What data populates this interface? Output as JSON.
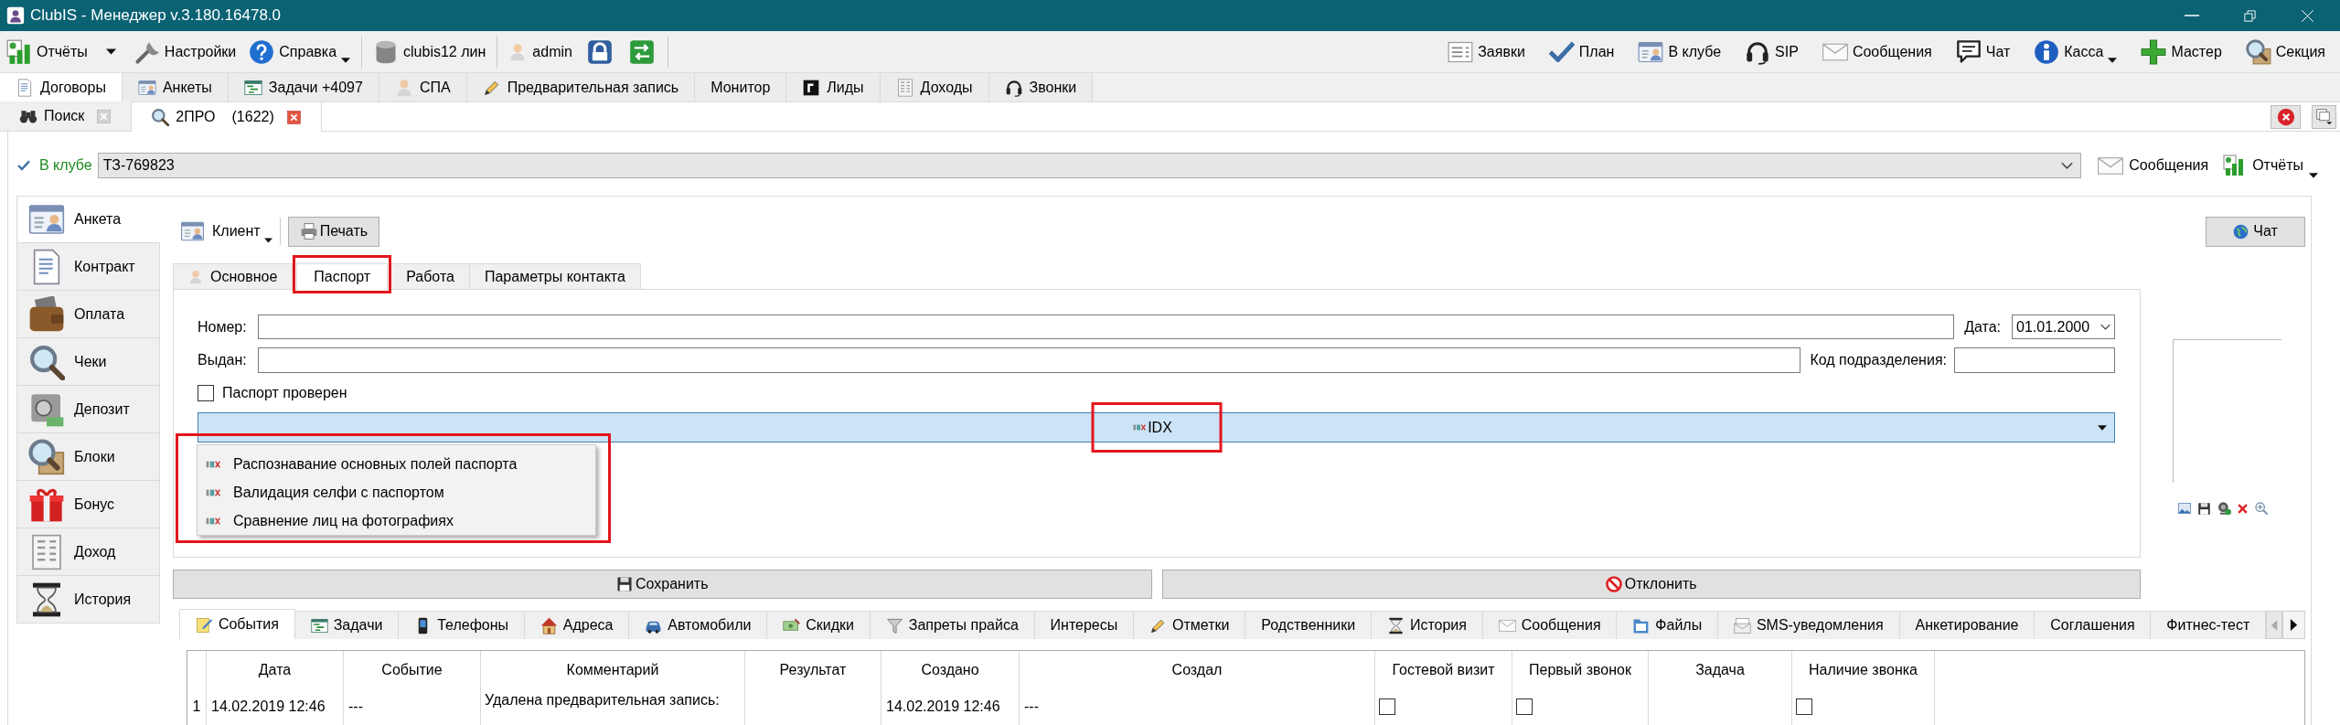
{
  "window": {
    "title": "ClubIS - Менеджер v.3.180.16478.0"
  },
  "toolbar": {
    "left_groups": [
      [
        {
          "kind": "button",
          "label": "Отчёты",
          "split_menu": true
        },
        {
          "kind": "button",
          "label": "Настройки"
        },
        {
          "kind": "button",
          "label": "Справка",
          "menu": true
        }
      ],
      [
        {
          "kind": "button",
          "label": "clubis12 лин"
        }
      ],
      [
        {
          "kind": "label",
          "label": "admin"
        },
        {
          "kind": "icon_button"
        },
        {
          "kind": "icon_button"
        }
      ]
    ],
    "right": [
      {
        "label": "Заявки"
      },
      {
        "label": "План"
      },
      {
        "label": "В клубе"
      },
      {
        "label": "SIP"
      },
      {
        "label": "Сообщения"
      },
      {
        "label": "Чат"
      },
      {
        "label": "Касса",
        "menu": true
      },
      {
        "label": "Мастер"
      },
      {
        "label": "Секция"
      }
    ]
  },
  "module_tabs": [
    {
      "label": "Договоры",
      "selected": true
    },
    {
      "label": "Анкеты",
      "selected": false
    },
    {
      "label": "Задачи +4097",
      "selected": false
    },
    {
      "label": "СПА",
      "selected": false
    },
    {
      "label": "Предварительная запись",
      "selected": false
    },
    {
      "label": "Монитор",
      "selected": false
    },
    {
      "label": "Лиды",
      "selected": false
    },
    {
      "label": "Доходы",
      "selected": false
    },
    {
      "label": "Звонки",
      "selected": false
    }
  ],
  "document_tabs": [
    {
      "label": "Поиск",
      "selected": false
    },
    {
      "label": "2ПРО",
      "count": "(1622)",
      "selected": true
    }
  ],
  "client_bar": {
    "status": "В клубе",
    "card": "ТЗ-769823",
    "actions": [
      {
        "label": "Сообщения"
      },
      {
        "label": "Отчёты",
        "menu": true
      }
    ]
  },
  "sidebar": {
    "items": [
      {
        "label": "Анкета",
        "selected": true
      },
      {
        "label": "Контракт",
        "selected": false
      },
      {
        "label": "Оплата",
        "selected": false
      },
      {
        "label": "Чеки",
        "selected": false
      },
      {
        "label": "Депозит",
        "selected": false
      },
      {
        "label": "Блоки",
        "selected": false
      },
      {
        "label": "Бонус",
        "selected": false
      },
      {
        "label": "Доход",
        "selected": false
      },
      {
        "label": "История",
        "selected": false
      }
    ]
  },
  "form_toolbar": {
    "buttons": [
      {
        "label": "Клиент",
        "kind": "menu"
      },
      {
        "label": "Печать",
        "kind": "push"
      }
    ],
    "chat_button": {
      "label": "Чат"
    }
  },
  "form_tabs": [
    {
      "label": "Основное",
      "selected": false,
      "highlighted": false
    },
    {
      "label": "Паспорт",
      "selected": true,
      "highlighted": true
    },
    {
      "label": "Работа",
      "selected": false,
      "highlighted": false
    },
    {
      "label": "Параметры контакта",
      "selected": false,
      "highlighted": false
    }
  ],
  "passport": {
    "number": {
      "label": "Номер:"
    },
    "date": {
      "label": "Дата:",
      "value": "01.01.2000"
    },
    "issued_by": {
      "label": "Выдан:"
    },
    "division_code": {
      "label": "Код подразделения:"
    },
    "verified": {
      "label": "Паспорт проверен",
      "checked": false
    },
    "service": {
      "value": "IDX",
      "highlighted": true,
      "expanded": true,
      "menu_highlighted": true,
      "options": [
        {
          "label": "Распознавание основных полей паспорта",
          "selected": false
        },
        {
          "label": "Валидация селфи с паспортом",
          "selected": false
        },
        {
          "label": "Сравнение лиц на фотографиях",
          "selected": false
        }
      ]
    }
  },
  "actions": [
    {
      "label": "Сохранить",
      "kind": "save"
    },
    {
      "label": "Отклонить",
      "kind": "decline"
    }
  ],
  "history_tabs": [
    {
      "label": "События",
      "selected": true
    },
    {
      "label": "Задачи",
      "selected": false
    },
    {
      "label": "Телефоны",
      "selected": false
    },
    {
      "label": "Адреса",
      "selected": false
    },
    {
      "label": "Автомобили",
      "selected": false
    },
    {
      "label": "Скидки",
      "selected": false
    },
    {
      "label": "Запреты прайса",
      "selected": false
    },
    {
      "label": "Интересы",
      "selected": false
    },
    {
      "label": "Отметки",
      "selected": false
    },
    {
      "label": "Родственники",
      "selected": false
    },
    {
      "label": "История",
      "selected": false
    },
    {
      "label": "Сообщения",
      "selected": false
    },
    {
      "label": "Файлы",
      "selected": false
    },
    {
      "label": "SMS-уведомления",
      "selected": false
    },
    {
      "label": "Анкетирование",
      "selected": false
    },
    {
      "label": "Соглашения",
      "selected": false
    },
    {
      "label": "Фитнес-тест",
      "selected": false
    }
  ],
  "events_table": {
    "columns": [
      "Дата",
      "Событие",
      "Комментарий",
      "Результат",
      "Создано",
      "Создал",
      "Гостевой визит",
      "Первый звонок",
      "Задача",
      "Наличие звонка"
    ],
    "rows": [
      {
        "number": "1",
        "cells": [
          {
            "kind": "text",
            "text": "14.02.2019 12:46"
          },
          {
            "kind": "text",
            "text": "---"
          },
          {
            "kind": "note",
            "text": "Удалена предварительная запись:"
          },
          null,
          {
            "kind": "text",
            "text": "14.02.2019 12:46"
          },
          {
            "kind": "text",
            "text": "---"
          },
          {
            "kind": "check",
            "checked": false
          },
          {
            "kind": "check",
            "checked": false
          },
          null,
          {
            "kind": "check",
            "checked": false
          }
        ]
      }
    ]
  }
}
